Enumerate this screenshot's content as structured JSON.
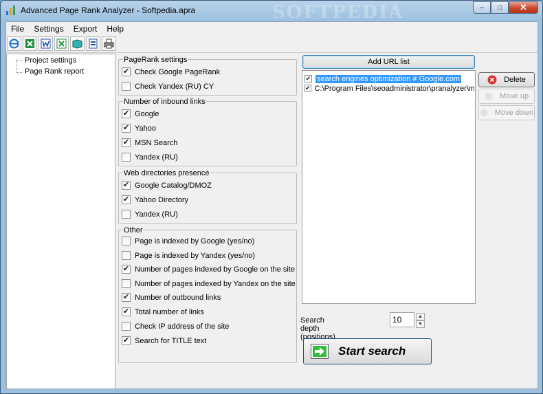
{
  "window": {
    "title": "Advanced Page Rank Analyzer - Softpedia.apra",
    "watermark": "SOFTPEDIA",
    "minimize": "‒",
    "maximize": "□",
    "close": "✕"
  },
  "menu": [
    "File",
    "Settings",
    "Export",
    "Help"
  ],
  "toolbar": {
    "icons": [
      "ie-icon",
      "excel-icon",
      "word-icon",
      "excel-export-icon",
      "open-book-icon",
      "report-icon",
      "print-icon"
    ]
  },
  "tree": {
    "items": [
      "Project settings",
      "Page Rank report"
    ]
  },
  "groups": {
    "pagerank": {
      "title": "PageRank settings",
      "items": [
        {
          "label": "Check Google PageRank",
          "checked": true
        },
        {
          "label": "Check Yandex (RU) CY",
          "checked": false
        }
      ]
    },
    "inbound": {
      "title": "Number of inbound links",
      "items": [
        {
          "label": "Google",
          "checked": true
        },
        {
          "label": "Yahoo",
          "checked": true
        },
        {
          "label": "MSN Search",
          "checked": true
        },
        {
          "label": "Yandex (RU)",
          "checked": false
        }
      ]
    },
    "directories": {
      "title": "Web directories presence",
      "items": [
        {
          "label": "Google Catalog/DMOZ",
          "checked": true
        },
        {
          "label": "Yahoo Directory",
          "checked": true
        },
        {
          "label": "Yandex (RU)",
          "checked": false
        }
      ]
    },
    "other": {
      "title": "Other",
      "items": [
        {
          "label": "Page is indexed by Google (yes/no)",
          "checked": false
        },
        {
          "label": "Page is indexed by Yandex (yes/no)",
          "checked": false
        },
        {
          "label": "Number of pages indexed by Google on the site",
          "checked": true
        },
        {
          "label": "Number of pages indexed by Yandex on the site",
          "checked": false
        },
        {
          "label": "Number of outbound links",
          "checked": true
        },
        {
          "label": "Total number of links",
          "checked": true
        },
        {
          "label": "Check IP address of the site",
          "checked": false
        },
        {
          "label": "Search for TITLE text",
          "checked": true
        }
      ]
    }
  },
  "urls": {
    "add_button": "Add URL list",
    "items": [
      {
        "text": "search engines optimization # Google.com",
        "checked": true,
        "selected": true
      },
      {
        "text": "C:\\Program Files\\seoadministrator\\pranalyzer\\ma",
        "checked": true,
        "selected": false
      }
    ],
    "delete_button": "Delete",
    "move_up_button": "Move up",
    "move_down_button": "Move down"
  },
  "search": {
    "depth_label": "Search depth (positions)",
    "depth_value": "10",
    "spin_up": "▲",
    "spin_down": "▼",
    "start_button": "Start search"
  },
  "check_mark": "✔",
  "colors": {
    "selection": "#3399ff",
    "delete_icon": "#d9342b",
    "start_icon": "#2fbf3a"
  }
}
